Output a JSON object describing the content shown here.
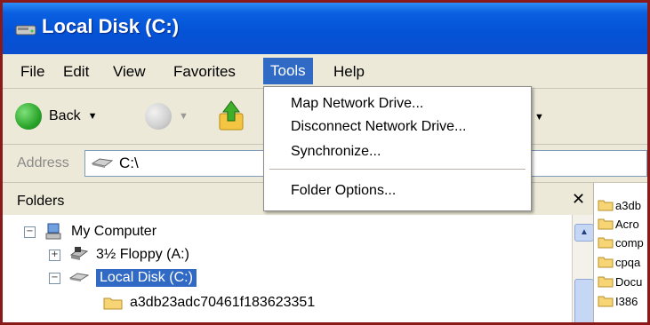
{
  "window": {
    "title": "Local Disk (C:)"
  },
  "menubar": {
    "items": [
      "File",
      "Edit",
      "View",
      "Favorites",
      "Tools",
      "Help"
    ],
    "active": "Tools"
  },
  "tools_menu": {
    "items": [
      "Map Network Drive...",
      "Disconnect Network Drive...",
      "Synchronize...",
      "Folder Options..."
    ]
  },
  "toolbar": {
    "back_label": "Back"
  },
  "addressbar": {
    "label": "Address",
    "value": "C:\\"
  },
  "folders": {
    "title": "Folders",
    "tree": [
      {
        "label": "My Computer",
        "expander": "−",
        "icon": "my-computer-icon"
      },
      {
        "label": "3½ Floppy (A:)",
        "expander": "+",
        "icon": "floppy-drive-icon"
      },
      {
        "label": "Local Disk (C:)",
        "expander": "−",
        "icon": "hard-disk-icon",
        "selected": true
      },
      {
        "label": "a3db23adc70461f183623351",
        "expander": "",
        "icon": "folder-icon"
      }
    ]
  },
  "content": {
    "items": [
      "a3db",
      "Acro",
      "comp",
      "cpqa",
      "Docu",
      "I386"
    ]
  },
  "colors": {
    "titlebar": "#0452d6",
    "selection": "#316ac5",
    "menu_bg": "#ece9d8",
    "window_border": "#8a1a1a"
  }
}
